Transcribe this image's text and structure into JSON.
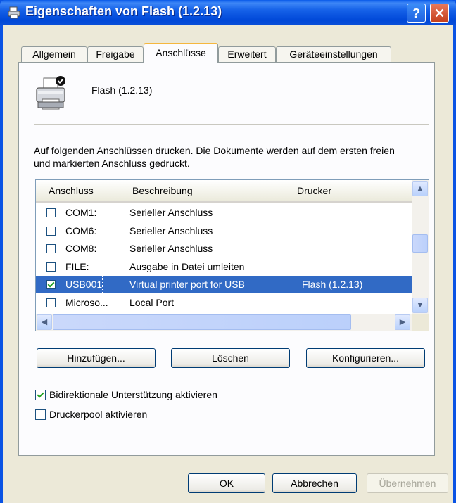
{
  "window": {
    "title": "Eigenschaften von Flash (1.2.13)",
    "help_label": "?",
    "close_label": "✕"
  },
  "tabs": [
    {
      "label": "Allgemein"
    },
    {
      "label": "Freigabe"
    },
    {
      "label": "Anschlüsse",
      "active": true
    },
    {
      "label": "Erweitert"
    },
    {
      "label": "Geräteeinstellungen"
    }
  ],
  "printer": {
    "name": "Flash (1.2.13)",
    "icon": "printer-icon"
  },
  "description": "Auf folgenden Anschlüssen drucken. Die Dokumente werden auf dem ersten freien und markierten Anschluss gedruckt.",
  "ports": {
    "columns": [
      "Anschluss",
      "Beschreibung",
      "Drucker"
    ],
    "rows": [
      {
        "port": "COM1:",
        "description": "Serieller Anschluss",
        "printer": "",
        "checked": false,
        "selected": false
      },
      {
        "port": "COM6:",
        "description": "Serieller Anschluss",
        "printer": "",
        "checked": false,
        "selected": false
      },
      {
        "port": "COM8:",
        "description": "Serieller Anschluss",
        "printer": "",
        "checked": false,
        "selected": false
      },
      {
        "port": "FILE:",
        "description": "Ausgabe in Datei umleiten",
        "printer": "",
        "checked": false,
        "selected": false
      },
      {
        "port": "USB001",
        "description": "Virtual printer port for USB",
        "printer": "Flash (1.2.13)",
        "checked": true,
        "selected": true
      },
      {
        "port": "Microso...",
        "description": "Local Port",
        "printer": "",
        "checked": false,
        "selected": false
      }
    ]
  },
  "port_buttons": {
    "add": "Hinzufügen...",
    "delete": "Löschen",
    "configure": "Konfigurieren..."
  },
  "options": {
    "bidirectional": {
      "label": "Bidirektionale Unterstützung aktivieren",
      "checked": true
    },
    "pool": {
      "label": "Druckerpool aktivieren",
      "checked": false
    }
  },
  "dialog_buttons": {
    "ok": "OK",
    "cancel": "Abbrechen",
    "apply": "Übernehmen"
  },
  "colors": {
    "titlebar": "#0a53e4",
    "selection": "#316ac5",
    "dialog_bg": "#ece9d8"
  }
}
